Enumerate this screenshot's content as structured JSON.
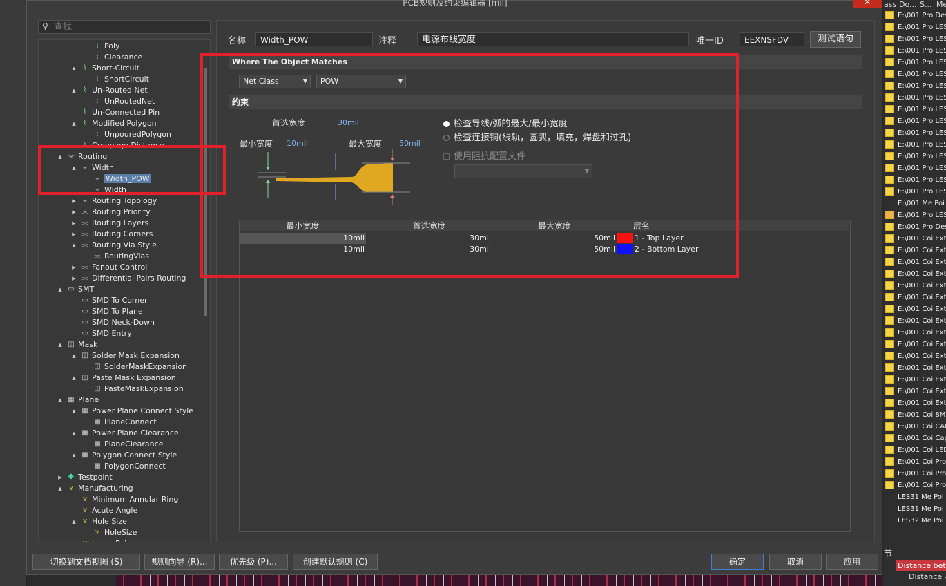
{
  "dialog": {
    "title": "PCB规则及约束编辑器 [mil]",
    "close_label": "✕"
  },
  "search": {
    "placeholder": "查找"
  },
  "tree": [
    {
      "label": "Poly",
      "level": 3,
      "icon": "rule-icon"
    },
    {
      "label": "Clearance",
      "level": 3,
      "icon": "rule-icon"
    },
    {
      "label": "Short-Circuit",
      "level": 2,
      "icon": "rule-icon",
      "toggle": "▲"
    },
    {
      "label": "ShortCircuit",
      "level": 3,
      "icon": "rule-icon"
    },
    {
      "label": "Un-Routed Net",
      "level": 2,
      "icon": "rule-icon",
      "toggle": "▲"
    },
    {
      "label": "UnRoutedNet",
      "level": 3,
      "icon": "rule-icon"
    },
    {
      "label": "Un-Connected Pin",
      "level": 2,
      "icon": "rule-icon"
    },
    {
      "label": "Modified Polygon",
      "level": 2,
      "icon": "rule-icon",
      "toggle": "▲"
    },
    {
      "label": "UnpouredPolygon",
      "level": 3,
      "icon": "rule-icon"
    },
    {
      "label": "Creepage Distance",
      "level": 2,
      "icon": "rule-icon"
    },
    {
      "label": "Routing",
      "level": 1,
      "icon": "routing-icon",
      "toggle": "▲"
    },
    {
      "label": "Width",
      "level": 2,
      "icon": "routing-icon",
      "toggle": "▲"
    },
    {
      "label": "Width_POW",
      "level": 3,
      "icon": "routing-icon",
      "selected": true
    },
    {
      "label": "Width",
      "level": 3,
      "icon": "routing-icon"
    },
    {
      "label": "Routing Topology",
      "level": 2,
      "icon": "routing-icon",
      "toggle": "▶"
    },
    {
      "label": "Routing Priority",
      "level": 2,
      "icon": "routing-icon",
      "toggle": "▶"
    },
    {
      "label": "Routing Layers",
      "level": 2,
      "icon": "routing-icon",
      "toggle": "▶"
    },
    {
      "label": "Routing Corners",
      "level": 2,
      "icon": "routing-icon",
      "toggle": "▶"
    },
    {
      "label": "Routing Via Style",
      "level": 2,
      "icon": "routing-icon",
      "toggle": "▲"
    },
    {
      "label": "RoutingVias",
      "level": 3,
      "icon": "routing-icon"
    },
    {
      "label": "Fanout Control",
      "level": 2,
      "icon": "routing-icon",
      "toggle": "▶"
    },
    {
      "label": "Differential Pairs Routing",
      "level": 2,
      "icon": "routing-icon",
      "toggle": "▶"
    },
    {
      "label": "SMT",
      "level": 1,
      "icon": "smt-icon",
      "toggle": "▲"
    },
    {
      "label": "SMD To Corner",
      "level": 2,
      "icon": "smt-icon"
    },
    {
      "label": "SMD To Plane",
      "level": 2,
      "icon": "smt-icon"
    },
    {
      "label": "SMD Neck-Down",
      "level": 2,
      "icon": "smt-icon"
    },
    {
      "label": "SMD Entry",
      "level": 2,
      "icon": "smt-icon"
    },
    {
      "label": "Mask",
      "level": 1,
      "icon": "mask-icon",
      "toggle": "▲"
    },
    {
      "label": "Solder Mask Expansion",
      "level": 2,
      "icon": "mask-icon",
      "toggle": "▲"
    },
    {
      "label": "SolderMaskExpansion",
      "level": 3,
      "icon": "mask-icon"
    },
    {
      "label": "Paste Mask Expansion",
      "level": 2,
      "icon": "mask-icon",
      "toggle": "▲"
    },
    {
      "label": "PasteMaskExpansion",
      "level": 3,
      "icon": "mask-icon"
    },
    {
      "label": "Plane",
      "level": 1,
      "icon": "plane-icon",
      "toggle": "▲"
    },
    {
      "label": "Power Plane Connect Style",
      "level": 2,
      "icon": "plane-icon",
      "toggle": "▲"
    },
    {
      "label": "PlaneConnect",
      "level": 3,
      "icon": "plane-icon"
    },
    {
      "label": "Power Plane Clearance",
      "level": 2,
      "icon": "plane-icon",
      "toggle": "▲"
    },
    {
      "label": "PlaneClearance",
      "level": 3,
      "icon": "plane-icon"
    },
    {
      "label": "Polygon Connect Style",
      "level": 2,
      "icon": "plane-icon",
      "toggle": "▲"
    },
    {
      "label": "PolygonConnect",
      "level": 3,
      "icon": "plane-icon"
    },
    {
      "label": "Testpoint",
      "level": 1,
      "icon": "testpoint-icon",
      "toggle": "▶"
    },
    {
      "label": "Manufacturing",
      "level": 1,
      "icon": "manufacturing-icon",
      "toggle": "▲"
    },
    {
      "label": "Minimum Annular Ring",
      "level": 2,
      "icon": "manufacturing-icon"
    },
    {
      "label": "Acute Angle",
      "level": 2,
      "icon": "manufacturing-icon"
    },
    {
      "label": "Hole Size",
      "level": 2,
      "icon": "manufacturing-icon",
      "toggle": "▲"
    },
    {
      "label": "HoleSize",
      "level": 3,
      "icon": "manufacturing-icon"
    },
    {
      "label": "Layer Pairs",
      "level": 2,
      "icon": "manufacturing-icon"
    }
  ],
  "rule": {
    "name_label": "名称",
    "name_value": "Width_POW",
    "comment_label": "注释",
    "comment_value": "电源布线宽度",
    "uid_label": "唯一ID",
    "uid_value": "EEXNSFDV",
    "test_button": "测试语句"
  },
  "match": {
    "section_title": "Where The Object Matches",
    "type": "Net Class",
    "value": "POW"
  },
  "constraints": {
    "section_title": "约束",
    "preferred_label": "首选宽度",
    "preferred_value": "30mil",
    "min_label": "最小宽度",
    "min_value": "10mil",
    "max_label": "最大宽度",
    "max_value": "50mil",
    "radio_check_trace": "检查导线/弧的最大/最小宽度",
    "radio_check_copper": "检查连接铜(线轨，圆弧，填充，焊盘和过孔)",
    "impedance_checkbox": "使用阻抗配置文件",
    "impedance_select": ""
  },
  "layer_table": {
    "headers": [
      "最小宽度",
      "首选宽度",
      "最大宽度",
      "层名"
    ],
    "rows": [
      {
        "min": "10mil",
        "pref": "30mil",
        "max": "50mil",
        "color": "#ff1010",
        "layer": "1 - Top Layer"
      },
      {
        "min": "10mil",
        "pref": "30mil",
        "max": "50mil",
        "color": "#1010ff",
        "layer": "2 - Bottom Layer"
      }
    ]
  },
  "bottom_buttons": {
    "doc_view": "切换到文档视图 (S)",
    "wizard": "规则向导 (R)...",
    "priority": "优先级 (P)...",
    "create_default": "创建默认规则 (C)",
    "ok": "确定",
    "cancel": "取消",
    "apply": "应用"
  },
  "file_panel": {
    "headers": [
      "ass",
      "Do...",
      "S...",
      "Me"
    ],
    "rows": [
      {
        "text": "E:\\001 Pro Des",
        "icon": "yellow"
      },
      {
        "text": "E:\\001 Pro LES",
        "icon": "yellow"
      },
      {
        "text": "E:\\001 Pro LES",
        "icon": "yellow"
      },
      {
        "text": "E:\\001 Pro LES",
        "icon": "yellow"
      },
      {
        "text": "E:\\001 Pro LES",
        "icon": "yellow"
      },
      {
        "text": "E:\\001 Pro LES",
        "icon": "yellow"
      },
      {
        "text": "E:\\001 Pro LES",
        "icon": "yellow"
      },
      {
        "text": "E:\\001 Pro LES",
        "icon": "yellow"
      },
      {
        "text": "E:\\001 Pro LES",
        "icon": "yellow"
      },
      {
        "text": "E:\\001 Pro LES",
        "icon": "yellow"
      },
      {
        "text": "E:\\001 Pro LES",
        "icon": "yellow"
      },
      {
        "text": "E:\\001 Pro LES",
        "icon": "yellow"
      },
      {
        "text": "E:\\001 Pro LES",
        "icon": "yellow"
      },
      {
        "text": "E:\\001 Pro LES",
        "icon": "yellow"
      },
      {
        "text": "E:\\001 Pro LES",
        "icon": "yellow"
      },
      {
        "text": "E:\\001 Pro LES",
        "icon": "yellow"
      },
      {
        "text": "E:\\001 Me Poi",
        "icon": "none"
      },
      {
        "text": "E:\\001 Pro LES",
        "icon": "orange"
      },
      {
        "text": "E:\\001 Pro Des",
        "icon": "yellow"
      },
      {
        "text": "E:\\001 Coi Ext",
        "icon": "yellow"
      },
      {
        "text": "E:\\001 Coi Ext",
        "icon": "yellow"
      },
      {
        "text": "E:\\001 Coi Ext",
        "icon": "yellow"
      },
      {
        "text": "E:\\001 Coi Ext",
        "icon": "yellow"
      },
      {
        "text": "E:\\001 Coi Ext",
        "icon": "yellow"
      },
      {
        "text": "E:\\001 Coi Ext",
        "icon": "yellow"
      },
      {
        "text": "E:\\001 Coi Ext",
        "icon": "yellow"
      },
      {
        "text": "E:\\001 Coi Ext",
        "icon": "yellow"
      },
      {
        "text": "E:\\001 Coi Ext",
        "icon": "yellow"
      },
      {
        "text": "E:\\001 Coi Ext",
        "icon": "yellow"
      },
      {
        "text": "E:\\001 Coi Ext",
        "icon": "yellow"
      },
      {
        "text": "E:\\001 Coi Ext",
        "icon": "yellow"
      },
      {
        "text": "E:\\001 Coi Ext",
        "icon": "yellow"
      },
      {
        "text": "E:\\001 Coi Ext",
        "icon": "yellow"
      },
      {
        "text": "E:\\001 Coi Ext",
        "icon": "yellow"
      },
      {
        "text": "E:\\001 Coi 8M",
        "icon": "yellow"
      },
      {
        "text": "E:\\001 Coi CAI",
        "icon": "yellow"
      },
      {
        "text": "E:\\001 Coi Cap",
        "icon": "yellow"
      },
      {
        "text": "E:\\001 Coi LED",
        "icon": "yellow"
      },
      {
        "text": "E:\\001 Coi Pro",
        "icon": "yellow"
      },
      {
        "text": "E:\\001 Coi Pro",
        "icon": "yellow"
      },
      {
        "text": "E:\\001 Coi Pro",
        "icon": "yellow"
      },
      {
        "text": "LES31 Me Poi",
        "icon": "none"
      },
      {
        "text": "LES31 Me Poi",
        "icon": "none"
      },
      {
        "text": "LES32 Me Poi",
        "icon": "none"
      }
    ],
    "prop_header": "节",
    "prop_distance": "Distance betw",
    "prop_value": "Distance ="
  }
}
